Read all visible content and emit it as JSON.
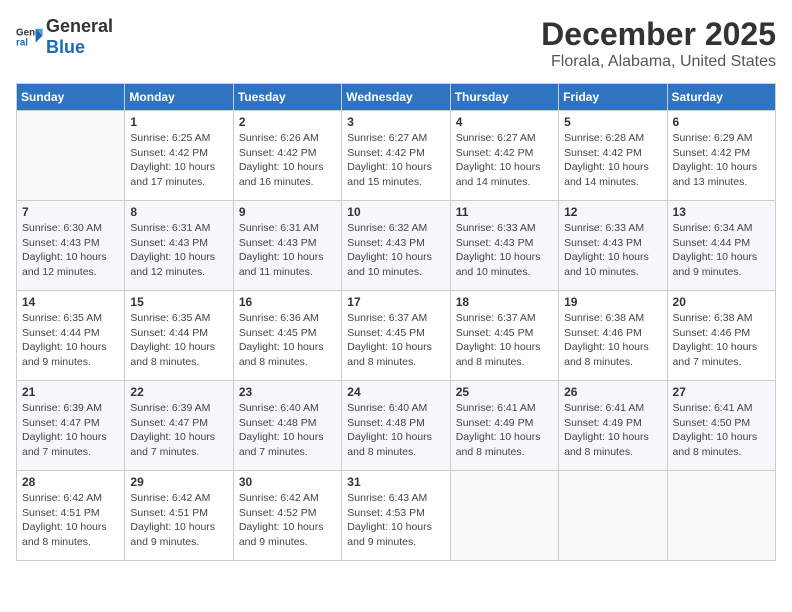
{
  "logo": {
    "general": "General",
    "blue": "Blue"
  },
  "title": "December 2025",
  "subtitle": "Florala, Alabama, United States",
  "headers": [
    "Sunday",
    "Monday",
    "Tuesday",
    "Wednesday",
    "Thursday",
    "Friday",
    "Saturday"
  ],
  "weeks": [
    [
      {
        "day": "",
        "info": ""
      },
      {
        "day": "1",
        "info": "Sunrise: 6:25 AM\nSunset: 4:42 PM\nDaylight: 10 hours\nand 17 minutes."
      },
      {
        "day": "2",
        "info": "Sunrise: 6:26 AM\nSunset: 4:42 PM\nDaylight: 10 hours\nand 16 minutes."
      },
      {
        "day": "3",
        "info": "Sunrise: 6:27 AM\nSunset: 4:42 PM\nDaylight: 10 hours\nand 15 minutes."
      },
      {
        "day": "4",
        "info": "Sunrise: 6:27 AM\nSunset: 4:42 PM\nDaylight: 10 hours\nand 14 minutes."
      },
      {
        "day": "5",
        "info": "Sunrise: 6:28 AM\nSunset: 4:42 PM\nDaylight: 10 hours\nand 14 minutes."
      },
      {
        "day": "6",
        "info": "Sunrise: 6:29 AM\nSunset: 4:42 PM\nDaylight: 10 hours\nand 13 minutes."
      }
    ],
    [
      {
        "day": "7",
        "info": "Sunrise: 6:30 AM\nSunset: 4:43 PM\nDaylight: 10 hours\nand 12 minutes."
      },
      {
        "day": "8",
        "info": "Sunrise: 6:31 AM\nSunset: 4:43 PM\nDaylight: 10 hours\nand 12 minutes."
      },
      {
        "day": "9",
        "info": "Sunrise: 6:31 AM\nSunset: 4:43 PM\nDaylight: 10 hours\nand 11 minutes."
      },
      {
        "day": "10",
        "info": "Sunrise: 6:32 AM\nSunset: 4:43 PM\nDaylight: 10 hours\nand 10 minutes."
      },
      {
        "day": "11",
        "info": "Sunrise: 6:33 AM\nSunset: 4:43 PM\nDaylight: 10 hours\nand 10 minutes."
      },
      {
        "day": "12",
        "info": "Sunrise: 6:33 AM\nSunset: 4:43 PM\nDaylight: 10 hours\nand 10 minutes."
      },
      {
        "day": "13",
        "info": "Sunrise: 6:34 AM\nSunset: 4:44 PM\nDaylight: 10 hours\nand 9 minutes."
      }
    ],
    [
      {
        "day": "14",
        "info": "Sunrise: 6:35 AM\nSunset: 4:44 PM\nDaylight: 10 hours\nand 9 minutes."
      },
      {
        "day": "15",
        "info": "Sunrise: 6:35 AM\nSunset: 4:44 PM\nDaylight: 10 hours\nand 8 minutes."
      },
      {
        "day": "16",
        "info": "Sunrise: 6:36 AM\nSunset: 4:45 PM\nDaylight: 10 hours\nand 8 minutes."
      },
      {
        "day": "17",
        "info": "Sunrise: 6:37 AM\nSunset: 4:45 PM\nDaylight: 10 hours\nand 8 minutes."
      },
      {
        "day": "18",
        "info": "Sunrise: 6:37 AM\nSunset: 4:45 PM\nDaylight: 10 hours\nand 8 minutes."
      },
      {
        "day": "19",
        "info": "Sunrise: 6:38 AM\nSunset: 4:46 PM\nDaylight: 10 hours\nand 8 minutes."
      },
      {
        "day": "20",
        "info": "Sunrise: 6:38 AM\nSunset: 4:46 PM\nDaylight: 10 hours\nand 7 minutes."
      }
    ],
    [
      {
        "day": "21",
        "info": "Sunrise: 6:39 AM\nSunset: 4:47 PM\nDaylight: 10 hours\nand 7 minutes."
      },
      {
        "day": "22",
        "info": "Sunrise: 6:39 AM\nSunset: 4:47 PM\nDaylight: 10 hours\nand 7 minutes."
      },
      {
        "day": "23",
        "info": "Sunrise: 6:40 AM\nSunset: 4:48 PM\nDaylight: 10 hours\nand 7 minutes."
      },
      {
        "day": "24",
        "info": "Sunrise: 6:40 AM\nSunset: 4:48 PM\nDaylight: 10 hours\nand 8 minutes."
      },
      {
        "day": "25",
        "info": "Sunrise: 6:41 AM\nSunset: 4:49 PM\nDaylight: 10 hours\nand 8 minutes."
      },
      {
        "day": "26",
        "info": "Sunrise: 6:41 AM\nSunset: 4:49 PM\nDaylight: 10 hours\nand 8 minutes."
      },
      {
        "day": "27",
        "info": "Sunrise: 6:41 AM\nSunset: 4:50 PM\nDaylight: 10 hours\nand 8 minutes."
      }
    ],
    [
      {
        "day": "28",
        "info": "Sunrise: 6:42 AM\nSunset: 4:51 PM\nDaylight: 10 hours\nand 8 minutes."
      },
      {
        "day": "29",
        "info": "Sunrise: 6:42 AM\nSunset: 4:51 PM\nDaylight: 10 hours\nand 9 minutes."
      },
      {
        "day": "30",
        "info": "Sunrise: 6:42 AM\nSunset: 4:52 PM\nDaylight: 10 hours\nand 9 minutes."
      },
      {
        "day": "31",
        "info": "Sunrise: 6:43 AM\nSunset: 4:53 PM\nDaylight: 10 hours\nand 9 minutes."
      },
      {
        "day": "",
        "info": ""
      },
      {
        "day": "",
        "info": ""
      },
      {
        "day": "",
        "info": ""
      }
    ]
  ]
}
